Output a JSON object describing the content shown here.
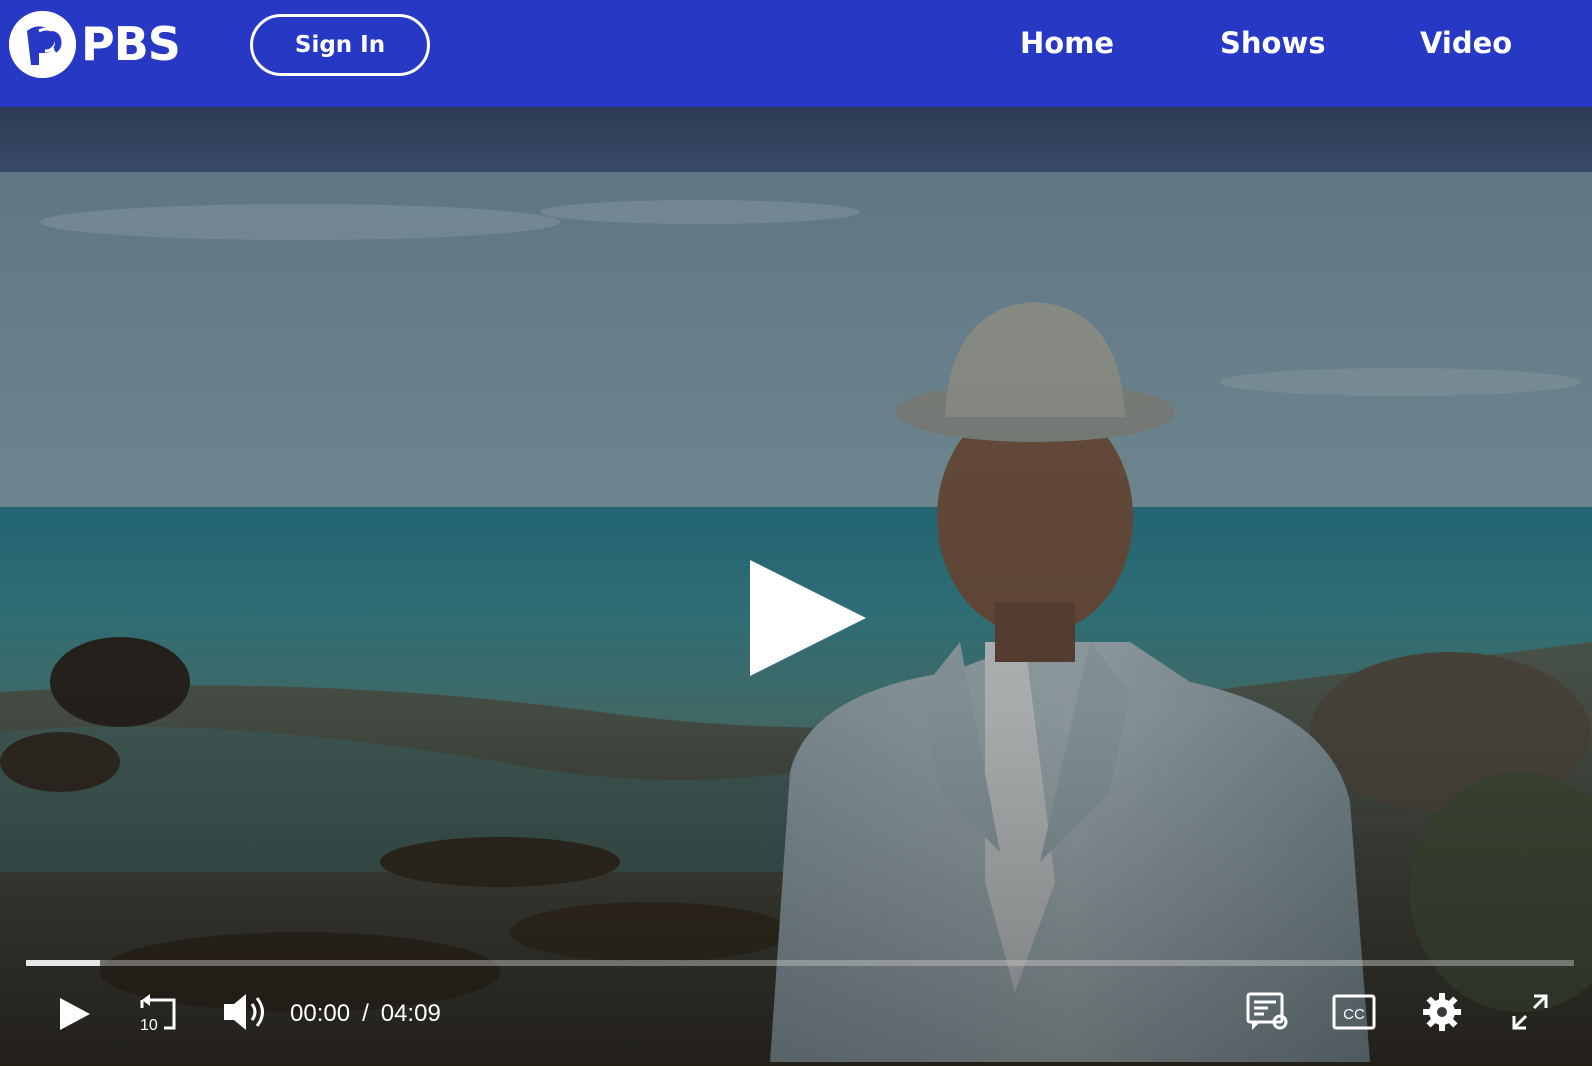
{
  "header": {
    "logo_text": "PBS",
    "signin_label": "Sign In",
    "nav": [
      {
        "label": "Home"
      },
      {
        "label": "Shows"
      },
      {
        "label": "Video"
      }
    ],
    "background_color": "#2638c4"
  },
  "player": {
    "current_time": "00:00",
    "time_separator": "/",
    "duration": "04:09",
    "progress_buffered": 0.048,
    "rewind_label": "10",
    "cc_label": "CC"
  }
}
